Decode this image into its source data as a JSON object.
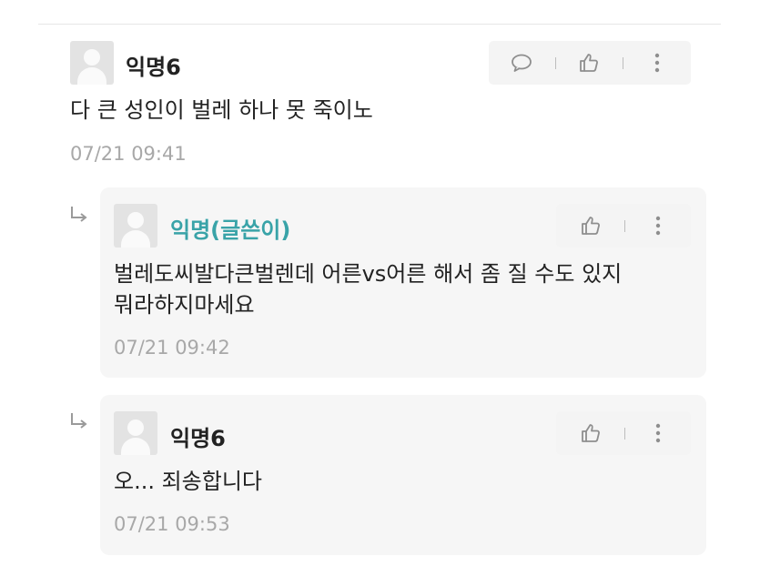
{
  "comments": [
    {
      "name": "익명6",
      "is_author": false,
      "text_lines": [
        "다 큰 성인이 벌레 하나 못 죽이노"
      ],
      "time": "07/21 09:41",
      "actions": [
        "reply-icon",
        "like-icon",
        "more-icon"
      ]
    }
  ],
  "replies": [
    {
      "name": "익명(글쓴이)",
      "is_author": true,
      "text_lines": [
        "벌레도씨발다큰벌렌데 어른vs어른 해서 좀 질 수도 있지",
        "뭐라하지마세요"
      ],
      "time": "07/21 09:42",
      "actions": [
        "like-icon",
        "more-icon"
      ]
    },
    {
      "name": "익명6",
      "is_author": false,
      "text_lines": [
        "오... 죄송합니다"
      ],
      "time": "07/21 09:53",
      "actions": [
        "like-icon",
        "more-icon"
      ]
    }
  ],
  "colors": {
    "author_name": "#39a3a8",
    "timestamp": "#a8a8a8",
    "reply_background": "#f6f6f6",
    "action_background": "#f4f4f4"
  }
}
